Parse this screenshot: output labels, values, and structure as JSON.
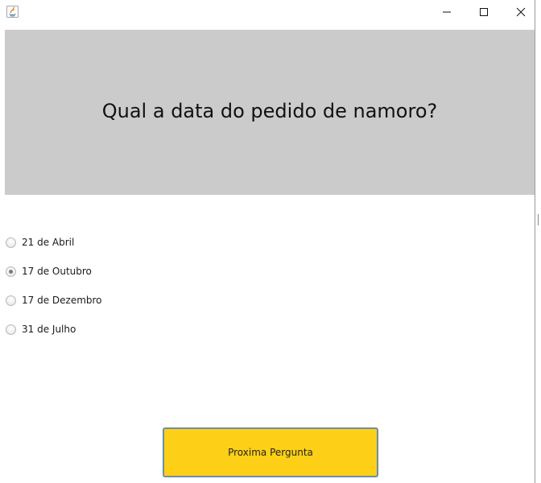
{
  "window": {
    "title": "",
    "controls": {
      "minimize_icon": "minimize-icon",
      "maximize_icon": "maximize-icon",
      "close_icon": "close-icon"
    }
  },
  "question": {
    "text": "Qual a data do pedido de namoro?",
    "background": "#cbcbcb"
  },
  "options": [
    {
      "label": "21 de Abril",
      "selected": false
    },
    {
      "label": "17 de Outubro",
      "selected": true
    },
    {
      "label": "17 de Dezembro",
      "selected": false
    },
    {
      "label": "31 de Julho",
      "selected": false
    }
  ],
  "next_button": {
    "label": "Proxima Pergunta",
    "color": "#fdd017"
  }
}
